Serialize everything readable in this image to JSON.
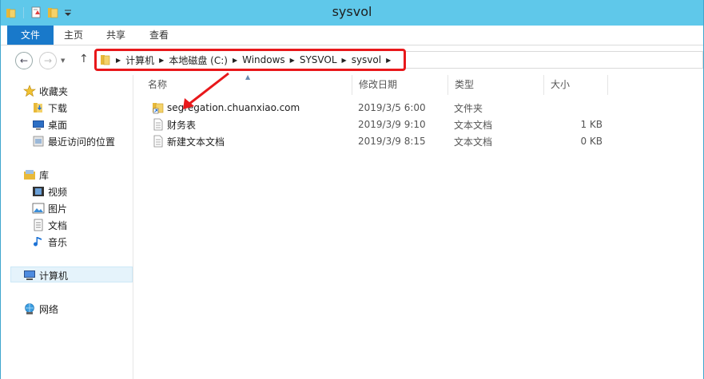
{
  "window": {
    "title": "sysvol"
  },
  "ribbon": {
    "tabs": [
      "文件",
      "主页",
      "共享",
      "查看"
    ]
  },
  "address": {
    "segments": [
      "计算机",
      "本地磁盘 (C:)",
      "Windows",
      "SYSVOL",
      "sysvol"
    ]
  },
  "sidebar": {
    "favorites": {
      "label": "收藏夹",
      "items": [
        "下载",
        "桌面",
        "最近访问的位置"
      ]
    },
    "library": {
      "label": "库",
      "items": [
        "视频",
        "图片",
        "文档",
        "音乐"
      ]
    },
    "computer": "计算机",
    "network": "网络"
  },
  "columns": {
    "name": "名称",
    "date": "修改日期",
    "type": "类型",
    "size": "大小"
  },
  "files": [
    {
      "name": "segregation.chuanxiao.com",
      "date": "2019/3/5 6:00",
      "type": "文件夹",
      "size": "",
      "icon": "folder-shortcut-icon"
    },
    {
      "name": "财务表",
      "date": "2019/3/9 9:10",
      "type": "文本文档",
      "size": "1 KB",
      "icon": "text-file-icon"
    },
    {
      "name": "新建文本文档",
      "date": "2019/3/9 8:15",
      "type": "文本文档",
      "size": "0 KB",
      "icon": "text-file-icon"
    }
  ],
  "annotation": {
    "color": "#e8181b"
  }
}
